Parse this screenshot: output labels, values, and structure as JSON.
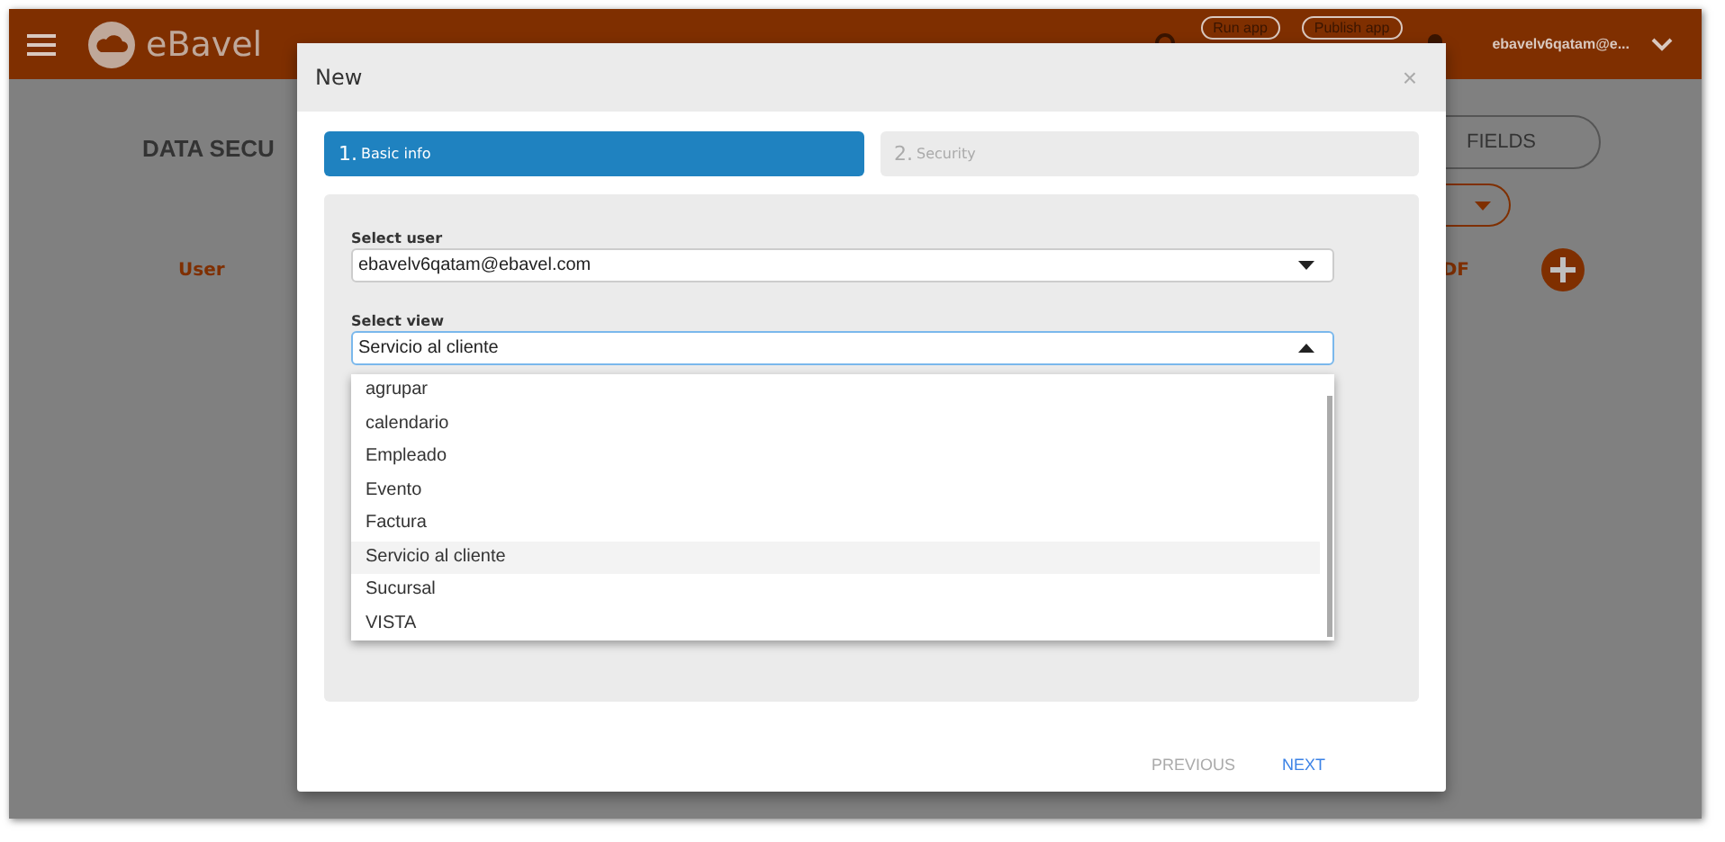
{
  "app_bar": {
    "brand": "eBavel",
    "buttons": [
      "Run app",
      "Publish app"
    ],
    "user": "ebavelv6qatam@e..."
  },
  "background": {
    "title": "DATA SECU",
    "fields_button": "FIELDS",
    "column_1": "User",
    "column_2": "DF"
  },
  "dialog": {
    "title": "New",
    "close": "×",
    "steps": [
      {
        "number": "1.",
        "label": "Basic info",
        "selected": true
      },
      {
        "number": "2.",
        "label": "Security",
        "selected": false
      }
    ],
    "fields": [
      {
        "label": "Select user",
        "value": "ebavelv6qatam@ebavel.com",
        "open": false
      },
      {
        "label": "Select view",
        "value": "Servicio al cliente",
        "open": true
      }
    ],
    "options": [
      {
        "label": "agrupar",
        "selected": false
      },
      {
        "label": "calendario",
        "selected": false
      },
      {
        "label": "Empleado",
        "selected": false
      },
      {
        "label": "Evento",
        "selected": false
      },
      {
        "label": "Factura",
        "selected": false
      },
      {
        "label": "Servicio al cliente",
        "selected": true
      },
      {
        "label": "Sucursal",
        "selected": false
      },
      {
        "label": "VISTA",
        "selected": false
      }
    ],
    "buttons": [
      {
        "label": "PREVIOUS",
        "disabled": true
      },
      {
        "label": "NEXT",
        "disabled": false
      }
    ]
  }
}
